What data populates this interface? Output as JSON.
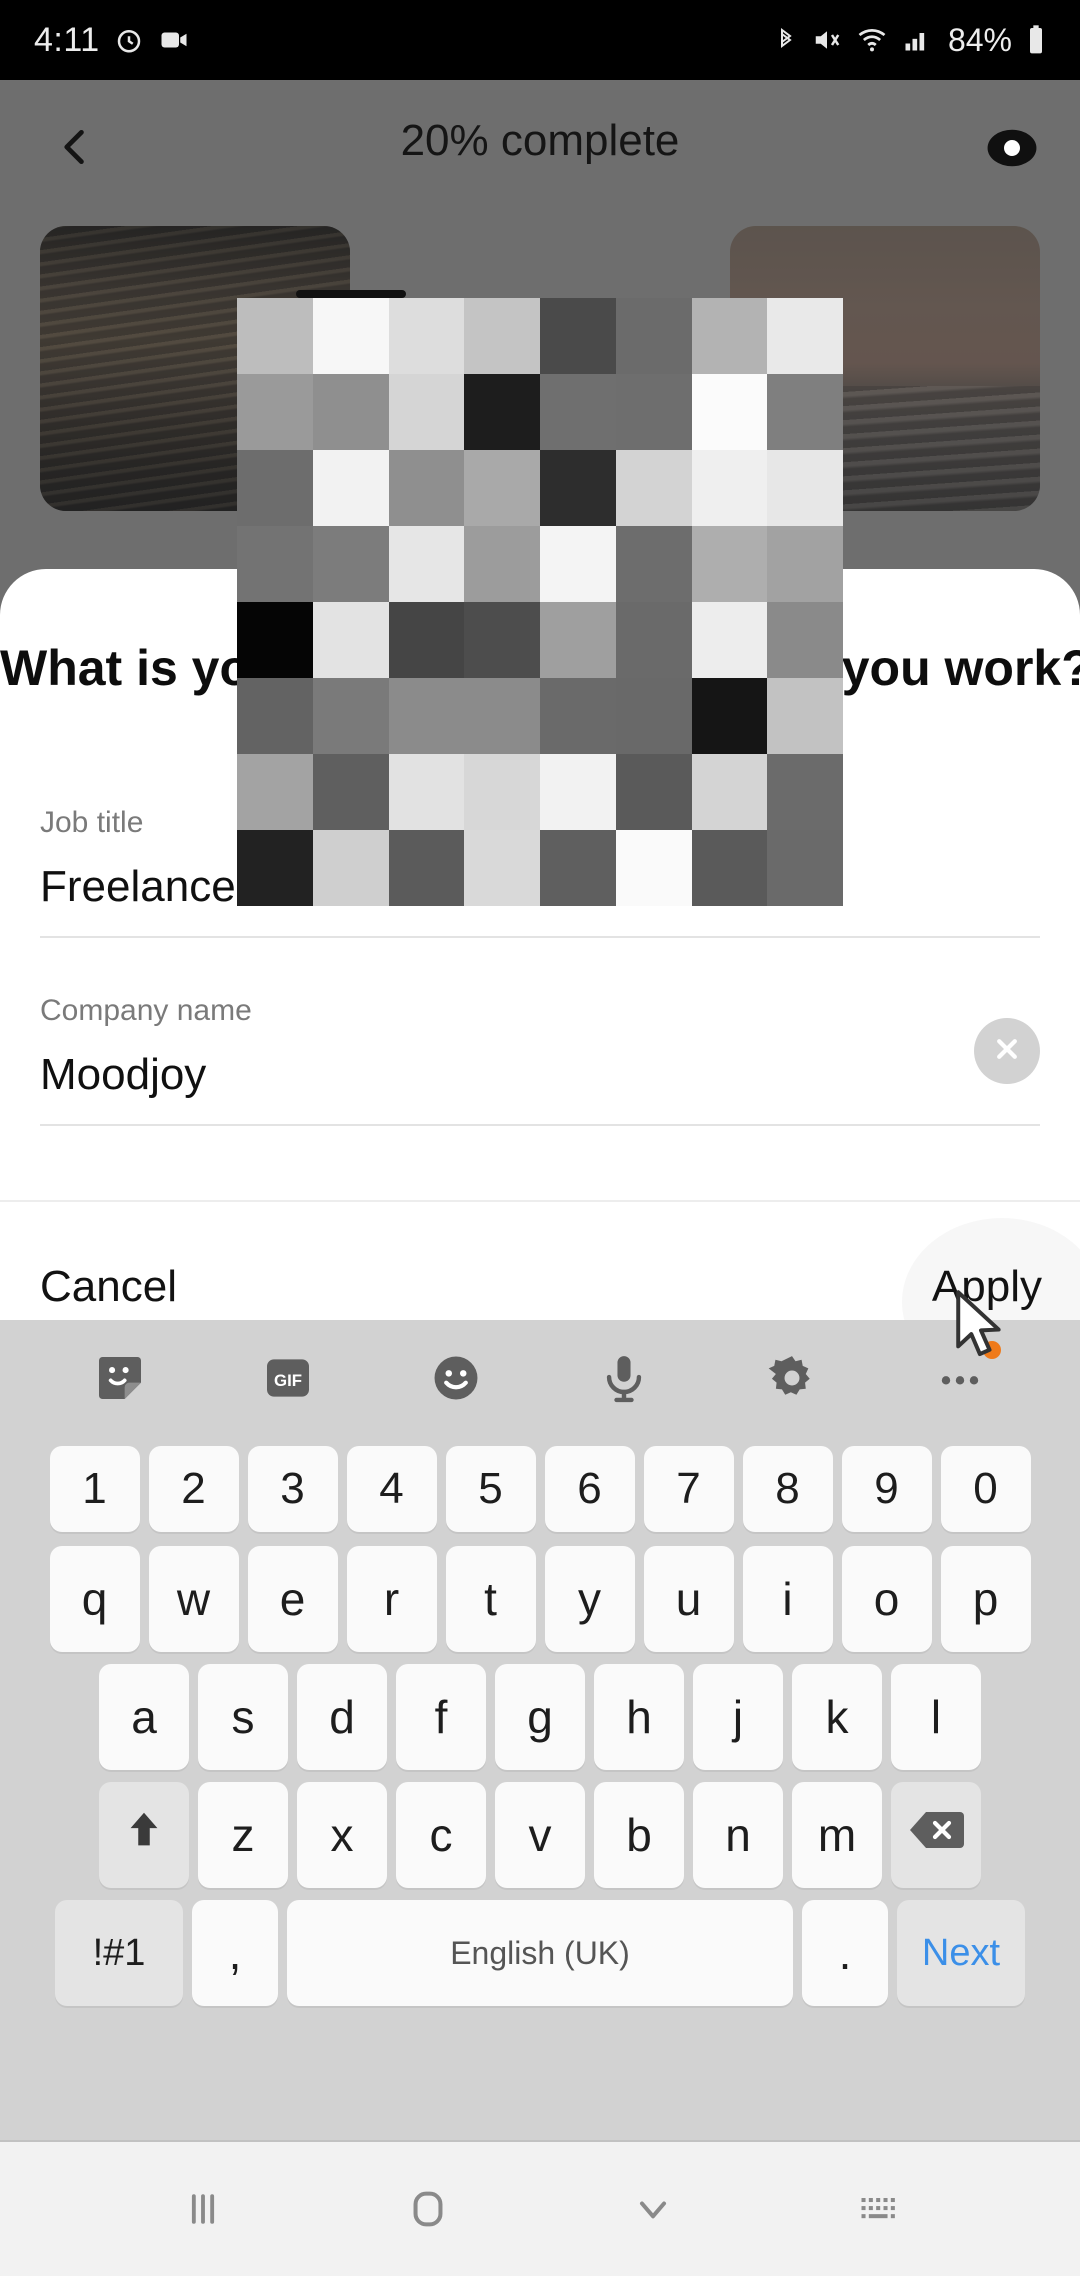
{
  "status_bar": {
    "time": "4:11",
    "battery_percent": "84%",
    "icons": [
      "alarm-icon",
      "screen-record-icon",
      "bluetooth-icon",
      "mute-icon",
      "wifi-icon",
      "signal-icon",
      "battery-icon"
    ]
  },
  "header": {
    "title": "20% complete",
    "back_icon": "back-chevron-icon",
    "preview_icon": "eye-icon",
    "progress_percent": 20
  },
  "sheet": {
    "title": "What is your job title and where do you work?",
    "fields": [
      {
        "label": "Job title",
        "value": "Freelance",
        "clear": false
      },
      {
        "label": "Company name",
        "value": "Moodjoy",
        "clear": true
      }
    ],
    "cancel_label": "Cancel",
    "apply_label": "Apply"
  },
  "redaction": {
    "note": "mosaic-overlay",
    "rows": 8,
    "cols": 8,
    "cells": [
      "#bdbdbd",
      "#f7f7f7",
      "#dddddd",
      "#c4c4c4",
      "#4a4a4a",
      "#6b6b6b",
      "#b3b3b3",
      "#e9e9e9",
      "#9a9a9a",
      "#8f8f8f",
      "#d5d5d5",
      "#1d1d1d",
      "#6f6f6f",
      "#6e6e6e",
      "#fbfbfb",
      "#7f7f7f",
      "#6d6d6d",
      "#f2f2f2",
      "#8f8f8f",
      "#a9a9a9",
      "#2d2d2d",
      "#d3d3d3",
      "#efefef",
      "#e7e7e7",
      "#737373",
      "#7c7c7c",
      "#e6e6e6",
      "#9c9c9c",
      "#f4f4f4",
      "#6d6d6d",
      "#aeaeae",
      "#a2a2a2",
      "#050505",
      "#e3e3e3",
      "#454545",
      "#4d4d4d",
      "#9f9f9f",
      "#6a6a6a",
      "#ededed",
      "#8a8a8a",
      "#636363",
      "#7a7a7a",
      "#8b8b8b",
      "#8b8b8b",
      "#6a6a6a",
      "#696969",
      "#151515",
      "#c2c2c2",
      "#a3a3a3",
      "#5f5f5f",
      "#e2e2e2",
      "#d7d7d7",
      "#f2f2f2",
      "#5a5a5a",
      "#d4d4d4",
      "#6b6b6b",
      "#222222",
      "#cfcfcf",
      "#5b5b5b",
      "#d9d9d9",
      "#5f5f5f",
      "#fafafa",
      "#5a5a5a",
      "#6a6a6a"
    ]
  },
  "keyboard": {
    "toolbar": [
      "sticker-icon",
      "gif-icon",
      "emoji-icon",
      "microphone-icon",
      "settings-gear-icon",
      "more-options-icon"
    ],
    "row1": [
      "1",
      "2",
      "3",
      "4",
      "5",
      "6",
      "7",
      "8",
      "9",
      "0"
    ],
    "row2": [
      "q",
      "w",
      "e",
      "r",
      "t",
      "y",
      "u",
      "i",
      "o",
      "p"
    ],
    "row3": [
      "a",
      "s",
      "d",
      "f",
      "g",
      "h",
      "j",
      "k",
      "l"
    ],
    "row4": {
      "shift": "shift-icon",
      "letters": [
        "z",
        "x",
        "c",
        "v",
        "b",
        "n",
        "m"
      ],
      "backspace": "backspace-icon"
    },
    "row5": {
      "symbols": "!#1",
      "comma": ",",
      "space": "English (UK)",
      "period": ".",
      "next": "Next"
    },
    "next_color": "#3b8fe8",
    "badge_color": "#ef7a1a"
  },
  "nav_bar": {
    "items": [
      "recents-icon",
      "home-icon",
      "hide-keyboard-icon",
      "keyboard-switch-icon"
    ]
  },
  "colors": {
    "scrim": "#6e6e6e",
    "sheet": "#ffffff",
    "keyboard_bg": "#d2d2d2",
    "key_bg": "#fafafa",
    "accent_blue": "#3b8fe8",
    "badge_orange": "#ef7a1a"
  }
}
